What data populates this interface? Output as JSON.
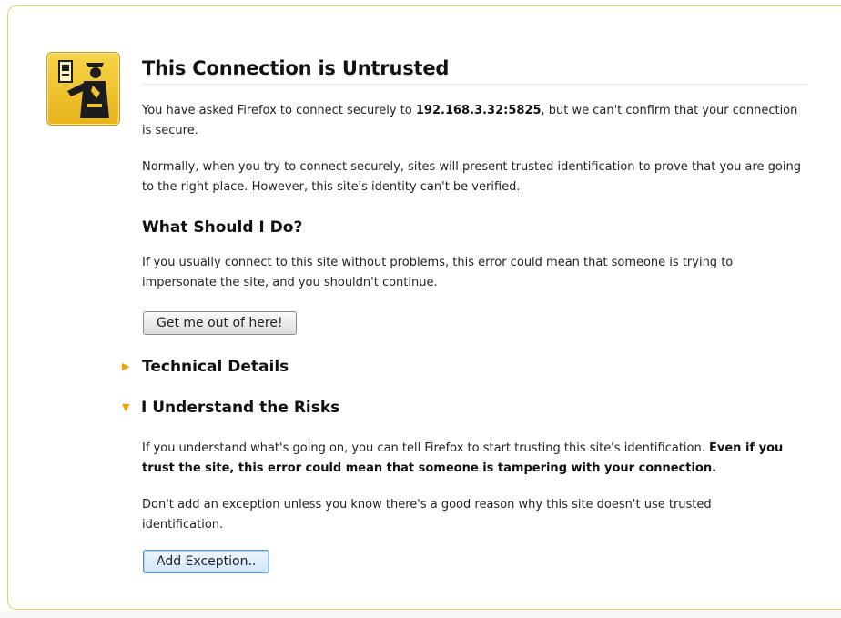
{
  "page": {
    "title": "This Connection is Untrusted",
    "intro_prefix": "You have asked Firefox to connect securely to ",
    "host": "192.168.3.32:5825",
    "intro_suffix": ", but we can't confirm that your connection is secure.",
    "normal_text": "Normally, when you try to connect securely, sites will present trusted identification to prove that you are going to the right place. However, this site's identity can't be verified.",
    "what_heading": "What Should I Do?",
    "what_text": "If you usually connect to this site without problems, this error could mean that someone is trying to impersonate the site, and you shouldn't continue.",
    "get_out_label": "Get me out of here!",
    "technical_label": "Technical Details",
    "risks_label": "I Understand the Risks",
    "risks_text_prefix": "If you understand what's going on, you can tell Firefox to start trusting this site's identification. ",
    "risks_text_bold": "Even if you trust the site, this error could mean that someone is tampering with your connection.",
    "exception_text": "Don't add an exception unless you know there's a good reason why this site doesn't use trusted identification.",
    "add_exception_label": "Add Exception..",
    "icons": {
      "badge": "security-officer-icon",
      "collapsed": "triangle-right-icon",
      "expanded": "triangle-down-icon"
    },
    "colors": {
      "badge": "#f0c22e",
      "twisty": "#f1a300",
      "border": "#f2c96a"
    }
  }
}
